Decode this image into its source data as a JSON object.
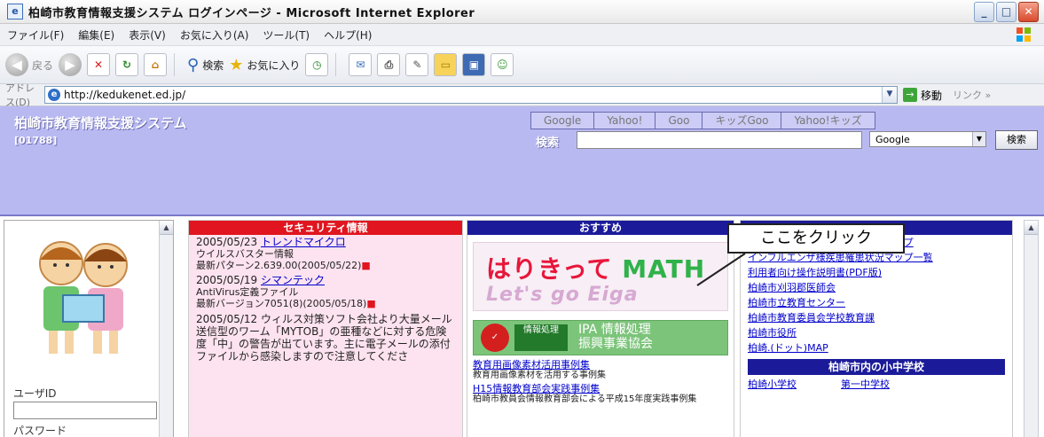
{
  "window": {
    "title": "柏崎市教育情報支援システム ログインページ - Microsoft Internet Explorer",
    "app_icon_glyph": "e",
    "controls": {
      "minimize": "_",
      "maximize": "□",
      "close": "✕"
    }
  },
  "menubar": {
    "items": [
      "ファイル(F)",
      "編集(E)",
      "表示(V)",
      "お気に入り(A)",
      "ツール(T)",
      "ヘルプ(H)"
    ]
  },
  "toolbar": {
    "back_label": "戻る",
    "search_label": "検索",
    "favorites_label": "お気に入り"
  },
  "addressbar": {
    "label": "アドレス(D)",
    "url": "http://kedukenet.ed.jp/",
    "go_label": "移動",
    "links_label": "リンク »"
  },
  "page_header": {
    "title": "柏崎市教育情報支援システム",
    "subtitle": "[01788]",
    "search_links": [
      "Google",
      "Yahoo!",
      "Goo",
      "キッズGoo",
      "Yahoo!キッズ"
    ],
    "search_label": "検索",
    "search_value": "",
    "engine_selected": "Google",
    "search_button": "検索"
  },
  "left_pane": {
    "userid_label": "ユーザID",
    "userid_value": "",
    "password_label": "パスワード"
  },
  "security": {
    "header": "セキュリティ情報",
    "items": [
      {
        "date": "2005/05/23",
        "source": "トレンドマイクロ",
        "line1": "ウイルスバスター情報",
        "line2": "最新パターン2.639.00(2005/05/22)",
        "new": "■"
      },
      {
        "date": "2005/05/19",
        "source": "シマンテック",
        "line1": "AntiVirus定義ファイル",
        "line2": "最新バージョン7051(8)(2005/05/18)",
        "new": "■"
      },
      {
        "date": "2005/05/12",
        "source": "",
        "line1": "ウィルス対策ソフト会社より大量メール送信型のワーム「MYTOB」の亜種などに対する危険度「中」の警告が出ています。主に電子メールの添付ファイルから感染しますので注意してくださ",
        "line2": "",
        "new": ""
      }
    ]
  },
  "recommend": {
    "header": "おすすめ",
    "banner_text": "はりきって",
    "banner_mt": "MATH",
    "banner_sub": "Let's go Eiga",
    "ipa_left": "情報処理",
    "ipa_text1": "IPA 情報処理",
    "ipa_text2": "振興事業協会",
    "links": [
      {
        "title": "教育用画像素材活用事例集",
        "desc": "教育用画像素材を活用する事例集"
      },
      {
        "title": "H15情報教育部会実践事例集",
        "desc": "柏崎市教員会情報教育部会による平成15年度実践事例集"
      }
    ]
  },
  "links_col": {
    "header": "",
    "links": [
      "柏崎市インフルエンザ流行状況マップ",
      "インフルエンザ様疾患罹患状況マップ一覧",
      "利用者向け操作説明書(PDF版)",
      "柏崎市刈羽郡医師会",
      "柏崎市立教育センター",
      "柏崎市教育委員会学校教育課",
      "柏崎市役所",
      "柏崎.(ドット)MAP"
    ],
    "subheader": "柏崎市内の小中学校",
    "schools": [
      "柏崎小学校",
      "第一中学校"
    ]
  },
  "callout": {
    "text": "ここをクリック"
  },
  "colors": {
    "header_bg": "#b9b9f2",
    "security_red": "#e0151f",
    "navy": "#1b1b9a",
    "link": "#0000cc"
  }
}
